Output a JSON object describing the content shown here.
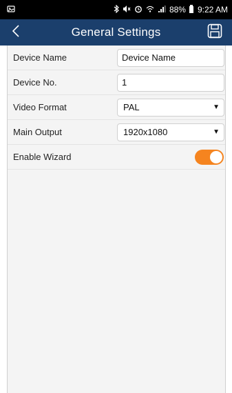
{
  "status_bar": {
    "battery_text": "88%",
    "time": "9:22 AM",
    "icons": [
      "notification-icon",
      "bluetooth-icon",
      "mute-icon",
      "alarm-icon",
      "wifi-icon",
      "signal-icon",
      "battery-icon"
    ]
  },
  "header": {
    "title": "General Settings",
    "back_icon": "chevron-left-icon",
    "save_icon": "save-icon",
    "background_color": "#1b3f6c"
  },
  "settings": {
    "device_name": {
      "label": "Device Name",
      "value": "Device Name"
    },
    "device_no": {
      "label": "Device No.",
      "value": "1"
    },
    "video_format": {
      "label": "Video Format",
      "value": "PAL"
    },
    "main_output": {
      "label": "Main Output",
      "value": "1920x1080"
    },
    "enable_wizard": {
      "label": "Enable Wizard",
      "enabled": true,
      "toggle_color": "#f5841f"
    }
  }
}
